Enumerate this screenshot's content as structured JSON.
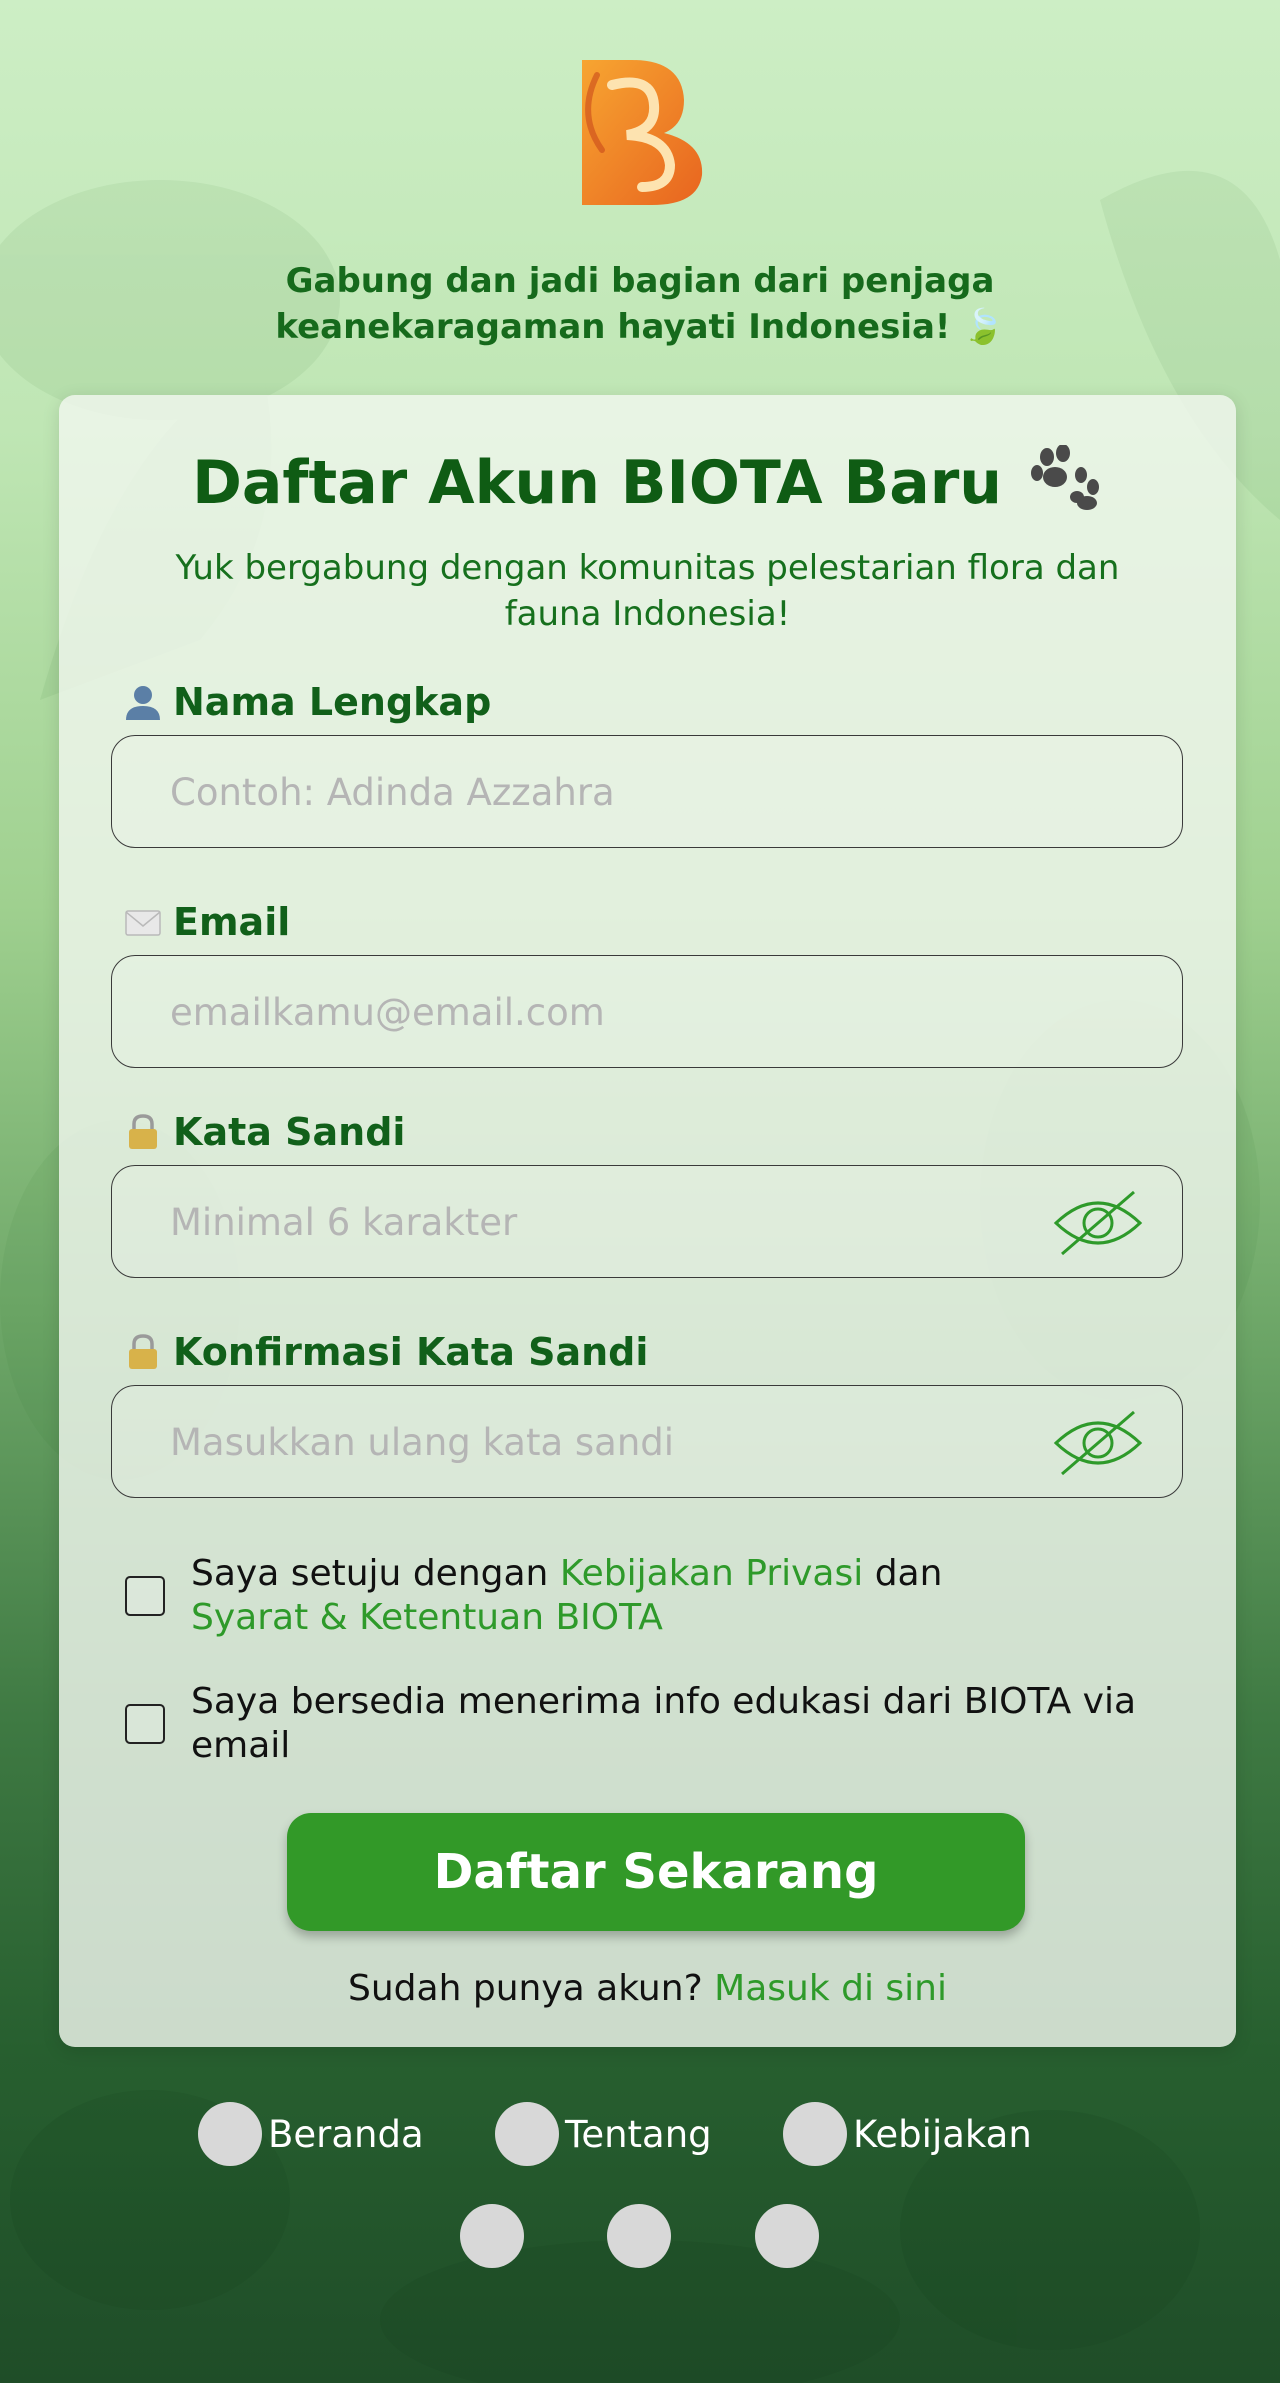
{
  "header": {
    "tagline_line1": "Gabung dan jadi bagian dari penjaga",
    "tagline_line2": "keanekaragaman hayati Indonesia! 🍃"
  },
  "form": {
    "title": "Daftar Akun BIOTA Baru",
    "subtitle": "Yuk bergabung dengan komunitas pelestarian flora dan fauna Indonesia!",
    "fields": [
      {
        "label": "Nama Lengkap",
        "icon": "person-icon",
        "placeholder": "Contoh: Adinda Azzahra",
        "value": ""
      },
      {
        "label": "Email",
        "icon": "envelope-icon",
        "placeholder": "emailkamu@email.com",
        "value": ""
      },
      {
        "label": "Kata Sandi",
        "icon": "lock-icon",
        "placeholder": "Minimal 6 karakter",
        "value": ""
      },
      {
        "label": "Konfirmasi Kata Sandi",
        "icon": "lock-icon",
        "placeholder": "Masukkan ulang kata sandi",
        "value": ""
      }
    ],
    "agree_prefix": "Saya setuju dengan",
    "privacy_link": "Kebijakan Privasi",
    "agree_mid": "dan",
    "terms_link": "Syarat & Ketentuan BIOTA",
    "newsletter_text": "Saya bersedia menerima info edukasi dari BIOTA via email",
    "submit_label": "Daftar Sekarang",
    "login_prompt": "Sudah punya akun?",
    "login_link": "Masuk di sini"
  },
  "footer": {
    "nav": [
      "Beranda",
      "Tentang",
      "Kebijakan"
    ]
  },
  "colors": {
    "primary": "#329928",
    "heading": "#0f5c14",
    "link": "#2e9a2a"
  }
}
